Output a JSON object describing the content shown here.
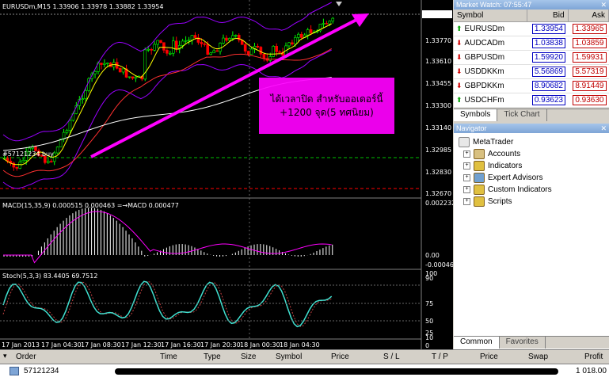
{
  "chart": {
    "header": "EURUSDm,M15  1.33906 1.33978 1.33882 1.33954",
    "order_label": "#57121234 buy",
    "price_labels": [
      "1.33954",
      "1.33770",
      "1.33610",
      "1.33455",
      "1.33300",
      "1.33140",
      "1.32985",
      "1.32830",
      "1.32670"
    ],
    "current_price": "1.33954",
    "macd_header": "MACD(15,35,9) 0.000515 0.000463   =→MACD 0.000477",
    "macd_labels": [
      "0.002232",
      "0.00",
      "-0.000461"
    ],
    "stoch_header": "Stoch(5,3,3) 83.4405 69.7512",
    "stoch_labels": [
      "100",
      "90",
      "75",
      "50",
      "25",
      "10",
      "0"
    ],
    "time_labels": [
      "17 Jan 2013",
      "17 Jan 04:30",
      "17 Jan 08:30",
      "17 Jan 12:30",
      "17 Jan 16:30",
      "17 Jan 20:30",
      "18 Jan 00:30",
      "18 Jan 04:30"
    ],
    "annotation_line1": "ได้เวลาปิด สำหรับออเดอร์นี้",
    "annotation_line2": "+1200 จุด(5 ทศนิยม)",
    "colors": {
      "annotation": "#ff00ff",
      "arrow": "#ff00ff",
      "candle_up": "#00ff00",
      "candle_down": "#ff0000",
      "bands": "#9900ff",
      "stoch": "#40e0d0"
    }
  },
  "market_watch": {
    "title": "Market Watch: 07:55:47",
    "columns": {
      "symbol": "Symbol",
      "bid": "Bid",
      "ask": "Ask"
    },
    "rows": [
      {
        "symbol": "EURUSDm",
        "bid": "1.33954",
        "ask": "1.33965",
        "dir": "up"
      },
      {
        "symbol": "AUDCADm",
        "bid": "1.03838",
        "ask": "1.03859",
        "dir": "down"
      },
      {
        "symbol": "GBPUSDm",
        "bid": "1.59920",
        "ask": "1.59931",
        "dir": "down"
      },
      {
        "symbol": "USDDKKm",
        "bid": "5.56869",
        "ask": "5.57319",
        "dir": "down"
      },
      {
        "symbol": "GBPDKKm",
        "bid": "8.90682",
        "ask": "8.91449",
        "dir": "down"
      },
      {
        "symbol": "USDCHFm",
        "bid": "0.93623",
        "ask": "0.93630",
        "dir": "up"
      }
    ],
    "tabs": [
      "Symbols",
      "Tick Chart"
    ]
  },
  "navigator": {
    "title": "Navigator",
    "root": "MetaTrader",
    "items": [
      {
        "label": "Accounts",
        "icon": "accounts-icon"
      },
      {
        "label": "Indicators",
        "icon": "indicators-icon"
      },
      {
        "label": "Expert Advisors",
        "icon": "expert-advisors-icon"
      },
      {
        "label": "Custom Indicators",
        "icon": "custom-indicators-icon"
      },
      {
        "label": "Scripts",
        "icon": "scripts-icon"
      }
    ],
    "tabs": [
      "Common",
      "Favorites"
    ]
  },
  "terminal": {
    "columns": [
      "Order",
      "Time",
      "Type",
      "Size",
      "Symbol",
      "Price",
      "S / L",
      "T / P",
      "Price",
      "Swap",
      "Profit"
    ],
    "row": {
      "order": "57121234",
      "profit": "1 018.00"
    }
  }
}
